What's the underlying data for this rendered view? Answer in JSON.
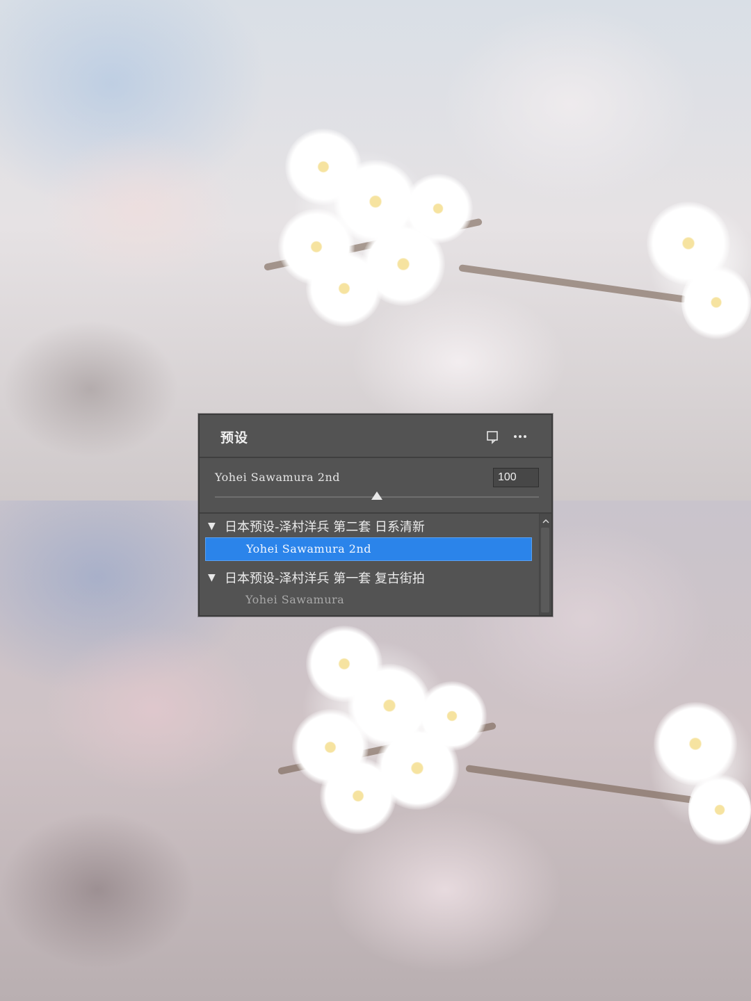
{
  "panel": {
    "title": "预设",
    "icons": {
      "new_preset": "new-preset-icon",
      "more": "more-options-icon"
    }
  },
  "current_preset": {
    "name": "Yohei Sawamura 2nd",
    "amount": "100",
    "slider_fraction": 0.5
  },
  "preset_list": {
    "groups": [
      {
        "label": "日本预设-泽村洋兵 第二套 日系清新",
        "expanded": true,
        "items": [
          {
            "label": "Yohei Sawamura 2nd",
            "selected": true
          }
        ]
      },
      {
        "label": "日本预设-泽村洋兵 第一套 复古街拍",
        "expanded": true,
        "items": [
          {
            "label": "Yohei Sawamura",
            "selected": false
          }
        ]
      }
    ]
  },
  "colors": {
    "panel_bg": "#535353",
    "selection": "#2b84ea",
    "text": "#ececec",
    "dim_text": "#a9a9a9"
  }
}
